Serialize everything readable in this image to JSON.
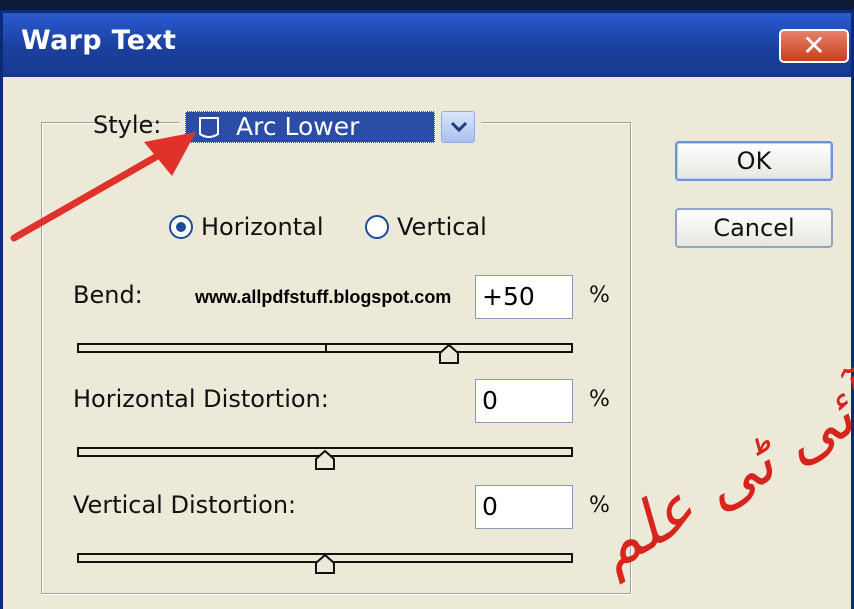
{
  "window": {
    "title": "Warp Text",
    "close_label": "✕"
  },
  "style": {
    "label": "Style:",
    "value": "Arc Lower",
    "icon": "arc-lower-icon"
  },
  "orientation": {
    "horizontal_label": "Horizontal",
    "vertical_label": "Vertical",
    "selected": "Horizontal"
  },
  "bend": {
    "label": "Bend:",
    "value": "+50",
    "unit": "%",
    "slider_value": 50
  },
  "horizontal_distortion": {
    "label": "Horizontal Distortion:",
    "value": "0",
    "unit": "%",
    "slider_value": 0
  },
  "vertical_distortion": {
    "label": "Vertical Distortion:",
    "value": "0",
    "unit": "%",
    "slider_value": 0
  },
  "buttons": {
    "ok": "OK",
    "cancel": "Cancel"
  },
  "overlay": {
    "watermark": "www.allpdfstuff.blogspot.com",
    "urdu_text": "آئی ٹی علم",
    "arrow_color": "#e0322a",
    "urdu_color": "#d8241c"
  },
  "colors": {
    "title_bar": "#1b3f9e",
    "dialog_bg": "#ece9d8",
    "selection": "#2b4da5"
  }
}
